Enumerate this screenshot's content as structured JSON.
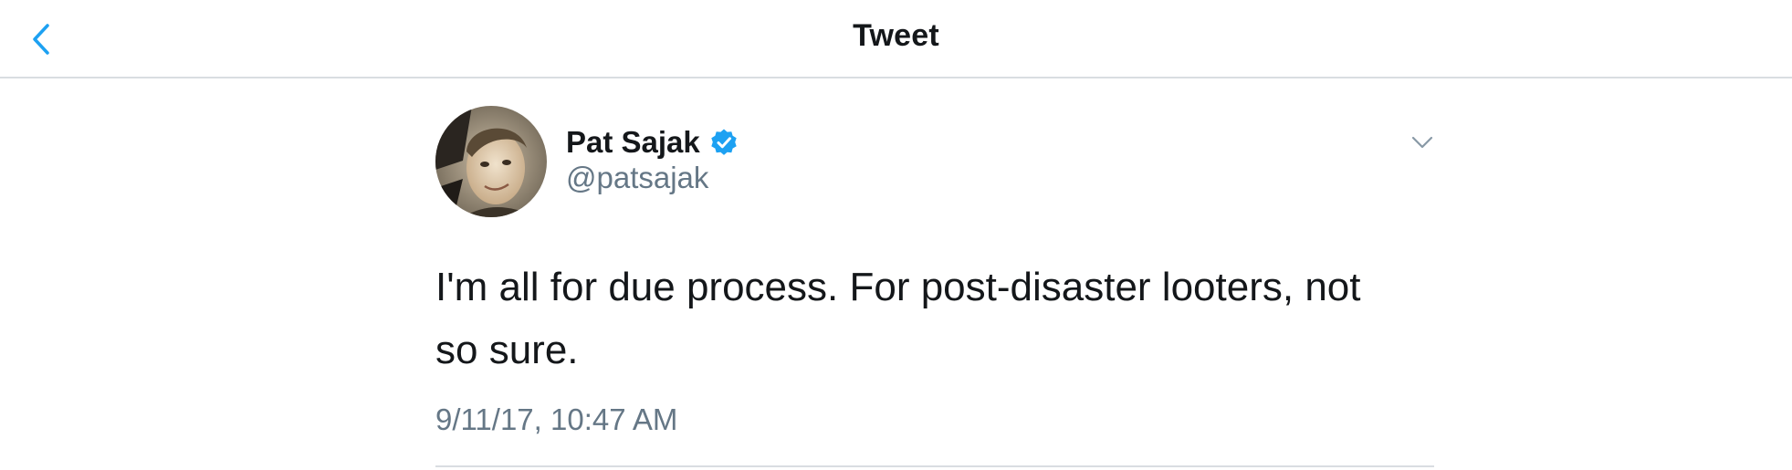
{
  "nav": {
    "title": "Tweet",
    "back_icon": "chevron-left-icon"
  },
  "tweet": {
    "author_name": "Pat Sajak",
    "author_handle": "@patsajak",
    "verified": true,
    "text": "I'm all for due process. For post-disaster looters, not so sure.",
    "timestamp": "9/11/17, 10:47 AM"
  },
  "colors": {
    "accent": "#1da1f2",
    "text_primary": "#14171a",
    "text_secondary": "#657786",
    "divider": "#d9dde1"
  }
}
